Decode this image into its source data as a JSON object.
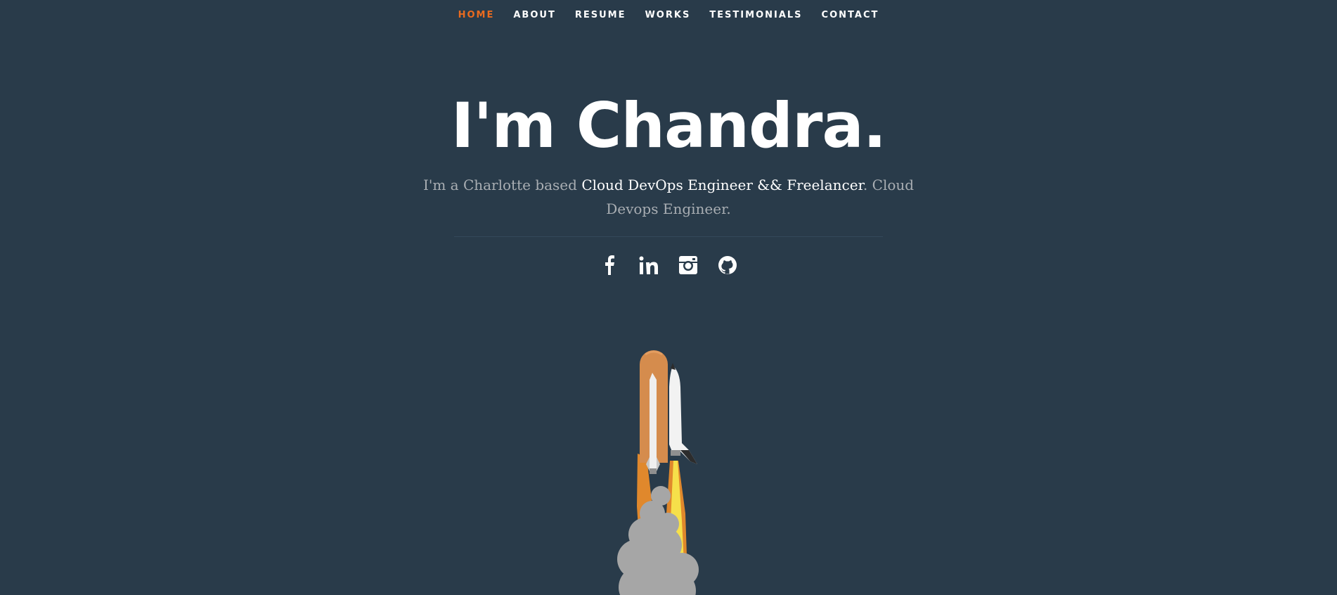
{
  "nav": {
    "items": [
      {
        "label": "HOME",
        "active": true
      },
      {
        "label": "ABOUT"
      },
      {
        "label": "RESUME"
      },
      {
        "label": "WORKS"
      },
      {
        "label": "TESTIMONIALS"
      },
      {
        "label": "CONTACT"
      }
    ]
  },
  "hero": {
    "title": "I'm Chandra.",
    "intro_prefix": "I'm a Charlotte based ",
    "intro_highlight": "Cloud DevOps Engineer && Freelancer",
    "intro_suffix": ". Cloud Devops Engineer."
  },
  "social": {
    "icons": [
      "facebook-icon",
      "linkedin-icon",
      "instagram-icon",
      "github-icon"
    ]
  },
  "colors": {
    "background": "#293b4a",
    "accent": "#ea6b1f",
    "text": "#ffffff",
    "muted": "#a9aeb3"
  }
}
